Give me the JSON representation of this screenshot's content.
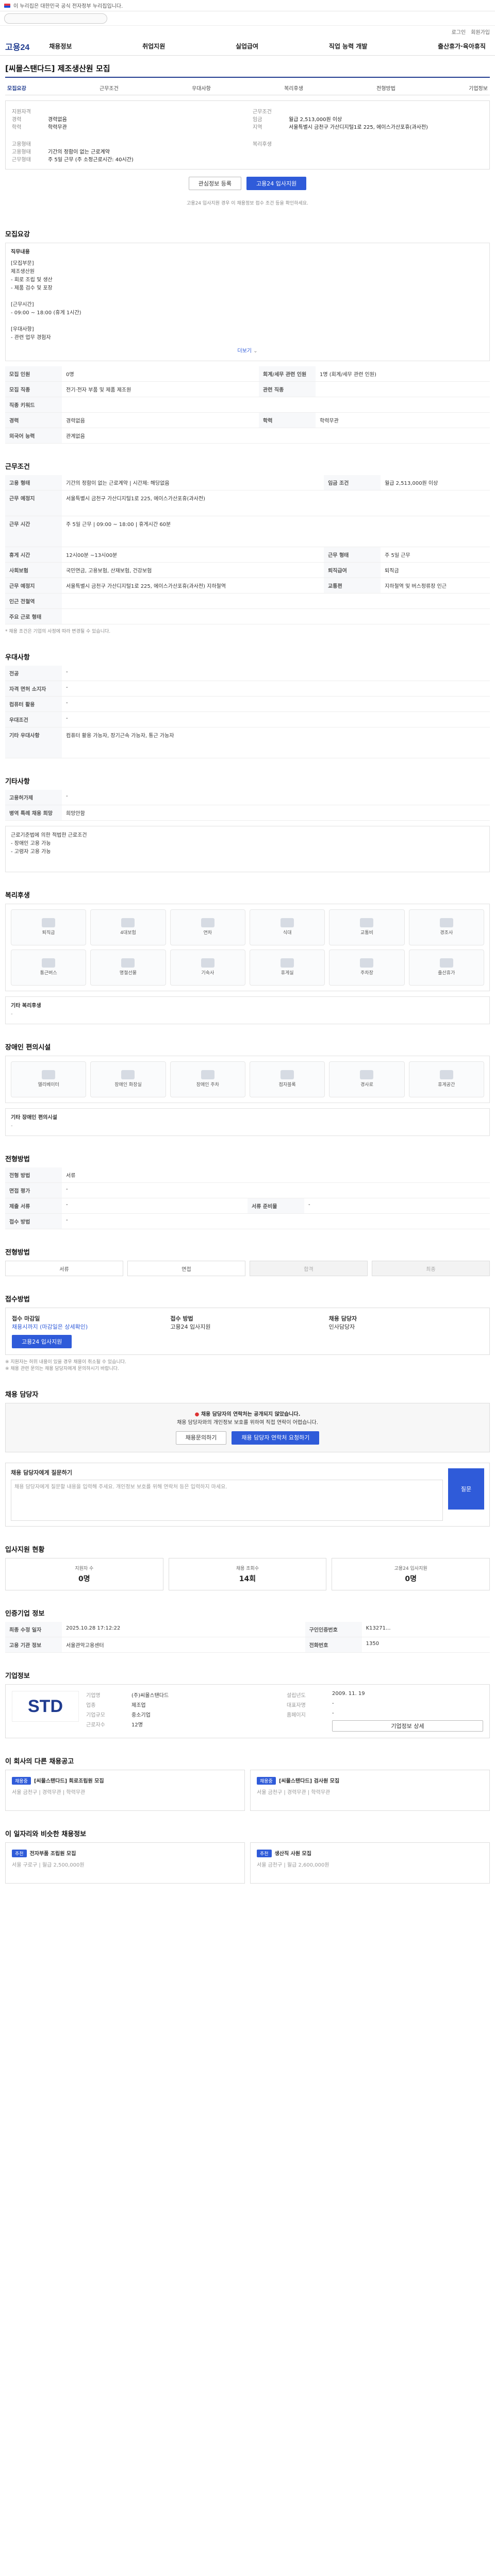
{
  "gov_banner": "이 누리집은 대한민국 공식 전자정부 누리집입니다.",
  "util": [
    "로그인",
    "회원가입"
  ],
  "logo": "고용24",
  "gnb": [
    "채용정보",
    "취업지원",
    "실업급여",
    "직업 능력 개발",
    "출산휴가·육아휴직"
  ],
  "job": {
    "title": "[씨몰스탠다드] 제조생산원 모집",
    "tabs": [
      "모집요강",
      "근무조건",
      "우대사항",
      "복리후생",
      "전형방법",
      "기업정보"
    ],
    "summary_left": [
      {
        "k": "지원자격",
        "v": ""
      },
      {
        "k": "경력",
        "v": "경력없음"
      },
      {
        "k": "학력",
        "v": "학력무관"
      }
    ],
    "summary_right": [
      {
        "k": "근무조건",
        "v": ""
      },
      {
        "k": "임금",
        "v": "월급 2,513,000원 이상"
      },
      {
        "k": "지역",
        "v": "서울특별시 금천구 가산디지털1로 225, 에이스가산포휴(과사전)"
      }
    ],
    "summary_more_left": [
      {
        "k": "고용형태",
        "v": ""
      },
      {
        "k": "고용형태",
        "v": "기간의 정함이 없는 근로계약"
      },
      {
        "k": "근무형태",
        "v": "주 5일 근무 (주 소정근로시간: 40시간)"
      }
    ],
    "summary_more_right": [
      {
        "k": "복리후생",
        "v": ""
      }
    ],
    "btn_scrap": "관심정보 등록",
    "btn_apply": "고용24 입사지원",
    "note": "고용24 입사지원 경우 이 채용정보 접수 조건 등을 확인하세요."
  },
  "recruit": {
    "head": "모집요강",
    "detail_label": "직무내용",
    "detail_text": "[모집부문]\n제조생산원\n- 회로 조립 및 생산\n- 제품 검수 및 포장\n\n[근무시간]\n- 09:00 ~ 18:00 (휴게 1시간)\n\n[우대사항]\n- 관련 업무 경험자",
    "more": "더보기",
    "rows": [
      {
        "th": "모집 인원",
        "td": "0명",
        "th2": "회계/세무 관련 인원",
        "td2": "1명 (회계/세무 관련 인원)"
      },
      {
        "th": "모집 직종",
        "td": "전기·전자 부품 및 제품 제조원",
        "th2": "관련 직종",
        "td2": ""
      },
      {
        "th": "직종 키워드",
        "td": "",
        "th2": "",
        "td2": ""
      },
      {
        "th": "경력",
        "td": "경력없음",
        "th2": "학력",
        "td2": "학력무관"
      },
      {
        "th": "외국어 능력",
        "td": "관계없음",
        "th2": "",
        "td2": ""
      }
    ]
  },
  "condition": {
    "head": "근무조건",
    "rows": [
      {
        "th": "고용 형태",
        "td": "기간의 정함이 없는 근로계약 | 시간제: 해당없음",
        "th2": "임금 조건",
        "td2": "월급 2,513,000원 이상"
      },
      {
        "th": "근무 예정지",
        "td": "서울특별시 금천구 가산디지털1로 225, 에이스가산포휴(과사전)",
        "th2": "",
        "td2": ""
      },
      {
        "th": "근무 시간",
        "td": "주 5일 근무 | 09:00 ~ 18:00 | 휴게시간 60분",
        "th2": "",
        "td2": ""
      },
      {
        "th": "휴게 시간",
        "td": "12시00분 ~13시00분",
        "th2": "근무 형태",
        "td2": "주 5일 근무"
      },
      {
        "th": "사회보험",
        "td": "국민연금, 고용보험, 산재보험, 건강보험",
        "th2": "퇴직급여",
        "td2": "퇴직금"
      },
      {
        "th": "근무 예정지",
        "td": "서울특별시 금천구 가산디지털1로 225, 에이스가산포휴(과사전) 지하철역",
        "th2": "교통편",
        "td2": "지하철역 및 버스정류장 인근"
      },
      {
        "th": "인근 전철역",
        "td": "",
        "th2": "",
        "td2": ""
      },
      {
        "th": "주요 근로 형태",
        "td": "",
        "th2": "",
        "td2": ""
      }
    ],
    "note": "* 채용 조건은 기업의 사정에 따라 변경될 수 있습니다."
  },
  "prefer": {
    "head": "우대사항",
    "rows": [
      {
        "th": "전공",
        "td": "-"
      },
      {
        "th": "자격 면허 소지자",
        "td": "-"
      },
      {
        "th": "컴퓨터 활용",
        "td": "-"
      },
      {
        "th": "우대조건",
        "td": "-"
      },
      {
        "th": "기타 우대사항",
        "td": "컴퓨터 활용 가능자, 장기근속 가능자, 통근 가능자"
      }
    ]
  },
  "other": {
    "head": "기타사항",
    "rows": [
      {
        "th": "고용허가제",
        "td": "-"
      },
      {
        "th": "병역 특례 채용 희망",
        "td": "희망안함"
      }
    ],
    "text": "근로기준법에 의한 적법한 근로조건\n- 장애인 고용 가능\n- 고령자 고용 가능"
  },
  "welfare": {
    "head": "복리후생",
    "items": [
      "퇴직금",
      "4대보험",
      "연차",
      "식대",
      "교통비",
      "경조사",
      "통근버스",
      "명절선물",
      "기숙사",
      "휴게실",
      "주차장",
      "출산휴가"
    ],
    "other_label": "기타 복리후생",
    "other_value": "-"
  },
  "disability": {
    "head": "장애인 편의시설",
    "items": [
      "엘리베이터",
      "장애인 화장실",
      "장애인 주차",
      "점자블록",
      "경사로",
      "휴게공간"
    ],
    "other_label": "기타 장애인 편의시설",
    "other_value": "-"
  },
  "selection": {
    "head": "전형방법",
    "rows": [
      {
        "th": "전형 방법",
        "td": "서류",
        "th2": "",
        "td2": ""
      },
      {
        "th": "면접 평가",
        "td": "-",
        "th2": "",
        "td2": ""
      },
      {
        "th": "제출 서류",
        "td": "-",
        "th2": "서류 준비물",
        "td2": "-"
      },
      {
        "th": "접수 방법",
        "td": "-",
        "th2": "",
        "td2": ""
      }
    ]
  },
  "steps": {
    "head": "전형방법",
    "items": [
      "서류",
      "면접",
      "합격",
      "최종"
    ]
  },
  "apply": {
    "head": "접수방법",
    "period_label": "접수 마감일",
    "period_value": "채용시까지 (마감일은 상세확인)",
    "method_label": "접수 방법",
    "method_value": "고용24 입사지원",
    "contact_label": "채용 담당자",
    "contact_value": "인사담당자",
    "btn": "고용24 입사지원",
    "notes": [
      "※ 지원자는 허위 내용이 있을 경우 채용이 취소될 수 있습니다.",
      "※ 채용 관련 문의는 채용 담당자에게 문의하시기 바랍니다."
    ]
  },
  "contact": {
    "head": "채용 담당자",
    "alert_title": "채용 담당자의 연락처는 공개되지 않았습니다.",
    "alert_body": "채용 담당자와의 개인정보 보호를 위하여 직접 연락이 어렵습니다.",
    "btn1": "채용문의하기",
    "btn2": "채용 담당자 연락처 요청하기"
  },
  "question": {
    "head": "채용 담당자에게 질문하기",
    "placeholder": "채용 담당자에게 질문할 내용을 입력해 주세요. 개인정보 보호를 위해 연락처 등은 입력하지 마세요.",
    "btn": "질문"
  },
  "status": {
    "head": "입사지원 현황",
    "stats": [
      {
        "label": "지원자 수",
        "val": "0명"
      },
      {
        "label": "채용 조회수",
        "val": "14회"
      },
      {
        "label": "고용24 입사지원",
        "val": "0명"
      }
    ]
  },
  "history": {
    "head": "인증기업 정보",
    "rows": [
      {
        "th": "최종 수정 일자",
        "td": "2025.10.28 17:12:22",
        "th2": "구인인증번호",
        "td2": "K13271..."
      },
      {
        "th": "고용 기관 정보",
        "td": "서울관악고용센터",
        "th2": "전화번호",
        "td2": "1350"
      }
    ]
  },
  "company": {
    "head": "기업정보",
    "logo_text": "STD",
    "name_label": "기업명",
    "name": "(주)씨몰스탠다드",
    "industry_label": "업종",
    "industry": "제조업",
    "size_label": "기업규모",
    "size": "중소기업",
    "staff_label": "근로자수",
    "staff": "12명",
    "year_label": "설립년도",
    "year": "2009. 11. 19",
    "ceo_label": "대표자명",
    "ceo": "-",
    "homepage_label": "홈페이지",
    "homepage": "-",
    "btn": "기업정보 상세"
  },
  "similar": {
    "head": "이 회사의 다른 채용공고",
    "items": [
      {
        "badge": "채용중",
        "title": "[씨몰스탠다드] 회로조립원 모집",
        "sub": "서울 금천구 | 경력무관 | 학력무관"
      },
      {
        "badge": "채용중",
        "title": "[씨몰스탠다드] 검사원 모집",
        "sub": "서울 금천구 | 경력무관 | 학력무관"
      }
    ]
  },
  "recommend": {
    "head": "이 일자리와 비슷한 채용정보",
    "items": [
      {
        "badge": "추천",
        "title": "전자부품 조립원 모집",
        "sub": "서울 구로구 | 월급 2,500,000원"
      },
      {
        "badge": "추천",
        "title": "생산직 사원 모집",
        "sub": "서울 금천구 | 월급 2,600,000원"
      }
    ]
  }
}
